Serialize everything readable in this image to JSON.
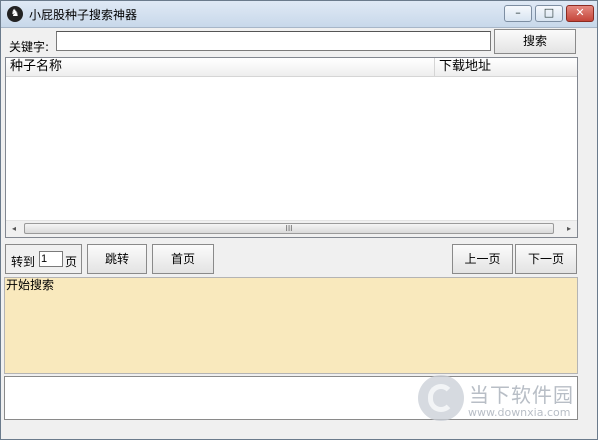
{
  "window": {
    "title": "小屁股种子搜索神器",
    "icon": "app-logo-icon",
    "min_glyph": "–",
    "max_glyph": "□",
    "close_glyph": "✕"
  },
  "search": {
    "label": "关键字:",
    "value": "",
    "button": "搜索"
  },
  "results": {
    "columns": [
      "种子名称",
      "下载地址"
    ],
    "rows": [],
    "scroll_left": "◂",
    "scroll_right": "▸",
    "scroll_grip": "III"
  },
  "pager": {
    "goto_label": "转到",
    "goto_value": "1",
    "goto_unit": "页",
    "jump_button": "跳转",
    "home_button": "首页",
    "prev_button": "上一页",
    "next_button": "下一页"
  },
  "log": {
    "text": "开始搜索"
  },
  "watermark": {
    "main": "当下软件园",
    "sub": "www.downxia.com"
  },
  "colors": {
    "log_bg": "#f9e9bd",
    "title_bg": "#dfe9f5"
  }
}
